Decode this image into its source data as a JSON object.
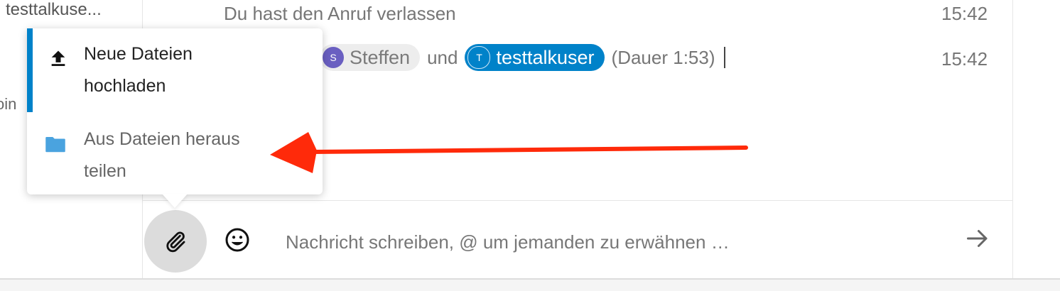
{
  "sidebar": {
    "conversation_title": "testtalkuse...",
    "partial_text": "oin"
  },
  "chat": {
    "messages": [
      {
        "text": "Du hast den Anruf verlassen",
        "time": "15:42"
      },
      {
        "mention1": {
          "initial": "S",
          "name": "Steffen"
        },
        "connector": "und",
        "mention2": {
          "initial": "T",
          "name": "testtalkuser"
        },
        "suffix": "(Dauer 1:53)",
        "time": "15:42"
      }
    ]
  },
  "attach_menu": {
    "items": [
      {
        "label_line1": "Neue Dateien",
        "label_line2": "hochladen",
        "icon": "upload-icon"
      },
      {
        "label_line1": "Aus Dateien heraus",
        "label_line2": "teilen",
        "icon": "folder-icon"
      }
    ]
  },
  "composer": {
    "placeholder": "Nachricht schreiben, @ um jemanden zu erwähnen …",
    "attach_icon": "paperclip-icon",
    "emoji_icon": "smiley-icon",
    "send_icon": "arrow-right-icon"
  },
  "colors": {
    "accent": "#0082c9",
    "annotation_arrow": "#ff2a0a",
    "folder": "#4aa3df"
  }
}
